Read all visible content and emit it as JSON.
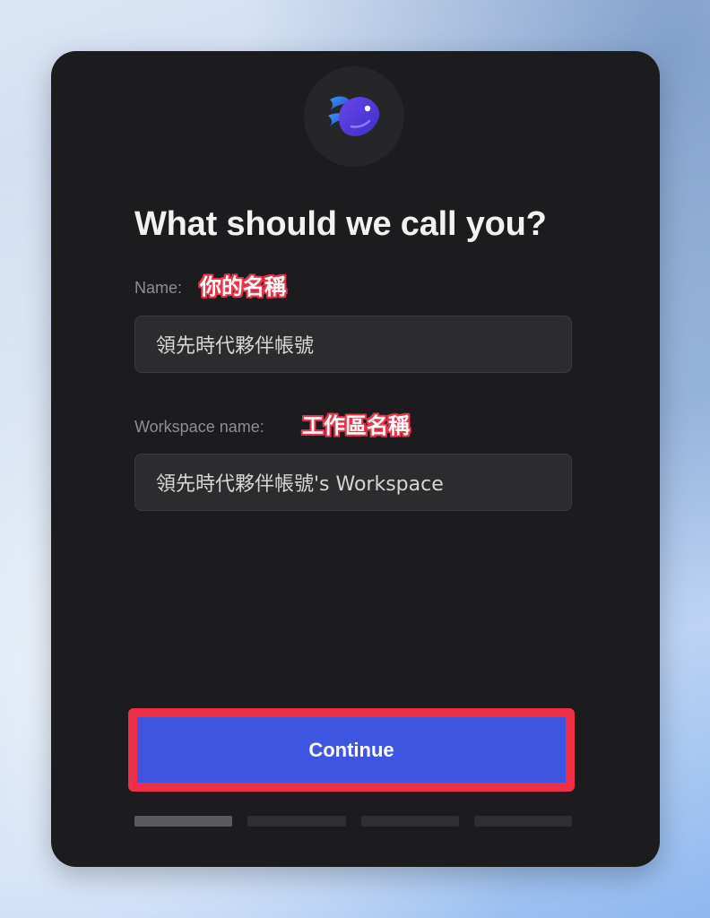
{
  "header": {
    "logo_icon": "fish-logo-icon",
    "title": "What should we call you?"
  },
  "form": {
    "name_label": "Name:",
    "name_annotation": "你的名稱",
    "name_value": "領先時代夥伴帳號",
    "workspace_label": "Workspace name:",
    "workspace_annotation": "工作區名稱",
    "workspace_value": "領先時代夥伴帳號's Workspace"
  },
  "actions": {
    "continue_label": "Continue"
  },
  "progress": {
    "current_step": 1,
    "total_steps": 4
  },
  "colors": {
    "card_bg": "#1c1c1e",
    "accent": "#3d55e0",
    "annotation": "#ee2f45"
  }
}
